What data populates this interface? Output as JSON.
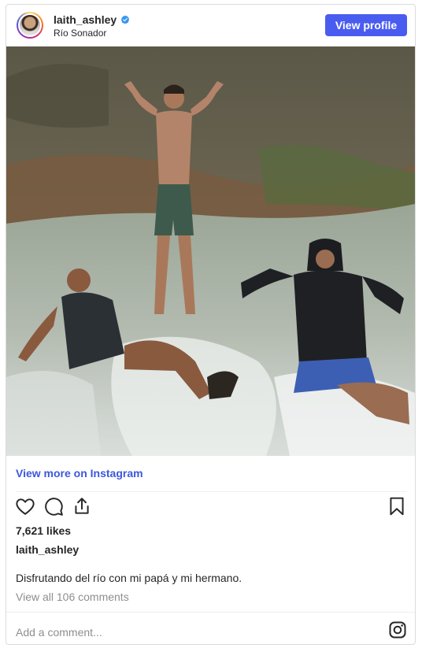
{
  "header": {
    "username": "laith_ashley",
    "location": "Río Sonador",
    "view_profile_label": "View profile"
  },
  "post": {
    "view_more_label": "View more on Instagram",
    "likes": "7,621 likes",
    "caption_username": "laith_ashley",
    "caption_text": "Disfrutando del río con mi papá y mi hermano.",
    "comments_label": "View all 106 comments",
    "comment_placeholder": "Add a comment..."
  },
  "icons": {
    "verified": "verified-badge-icon",
    "like": "heart-icon",
    "comment": "comment-bubble-icon",
    "share": "share-icon",
    "save": "bookmark-icon",
    "instagram": "instagram-icon"
  },
  "colors": {
    "accent": "#4a5cf0",
    "link": "#3b57dc",
    "verified": "#3797f0",
    "muted": "#8e8e8e"
  }
}
